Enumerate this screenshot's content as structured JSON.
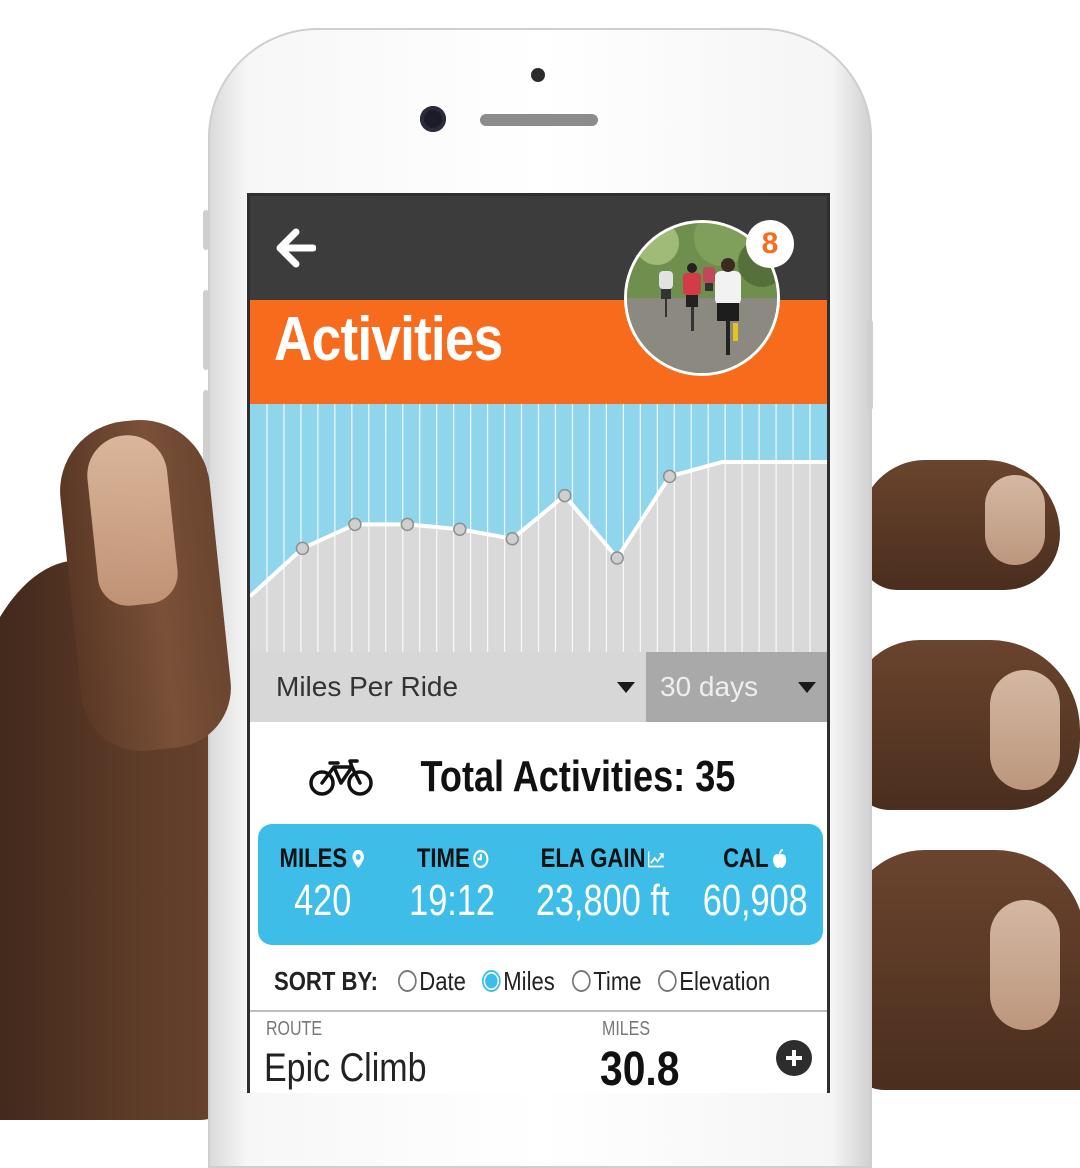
{
  "header": {
    "title": "Activities",
    "notification_count": "8"
  },
  "chart_data": {
    "type": "area",
    "title": "",
    "xlabel": "",
    "ylabel": "",
    "x": [
      0,
      1,
      2,
      3,
      4,
      5,
      6,
      7,
      8,
      9,
      10,
      11
    ],
    "values": [
      12,
      22,
      27,
      27,
      26,
      24,
      33,
      20,
      37,
      40,
      40,
      40
    ],
    "markers": [
      1,
      2,
      3,
      4,
      5,
      6,
      7,
      8
    ],
    "ylim": [
      0,
      50
    ],
    "grid": true,
    "colors": {
      "background": "#8fd6ec",
      "area": "#d9d9d9",
      "line": "#ffffff",
      "gridline": "#ffffff"
    }
  },
  "filters": {
    "metric": "Miles Per Ride",
    "range": "30 days"
  },
  "summary": {
    "total_label": "Total Activities: 35",
    "icon": "bike-icon"
  },
  "stats": [
    {
      "label": "MILES",
      "value": "420",
      "icon": "location-pin-icon"
    },
    {
      "label": "TIME",
      "value": "19:12",
      "icon": "clock-icon"
    },
    {
      "label": "ELA GAIN",
      "value": "23,800 ft",
      "icon": "trend-icon"
    },
    {
      "label": "CAL",
      "value": "60,908",
      "icon": "apple-icon"
    }
  ],
  "sort": {
    "label": "SORT BY:",
    "options": [
      "Date",
      "Miles",
      "Time",
      "Elevation"
    ],
    "selected": "Miles"
  },
  "table": {
    "columns": [
      "ROUTE",
      "MILES"
    ],
    "rows": [
      {
        "route": "Epic Climb",
        "miles": "30.8"
      }
    ]
  },
  "colors": {
    "accent": "#f76b1c",
    "stats_bg": "#3dbde8",
    "topbar": "#3c3c3c"
  }
}
